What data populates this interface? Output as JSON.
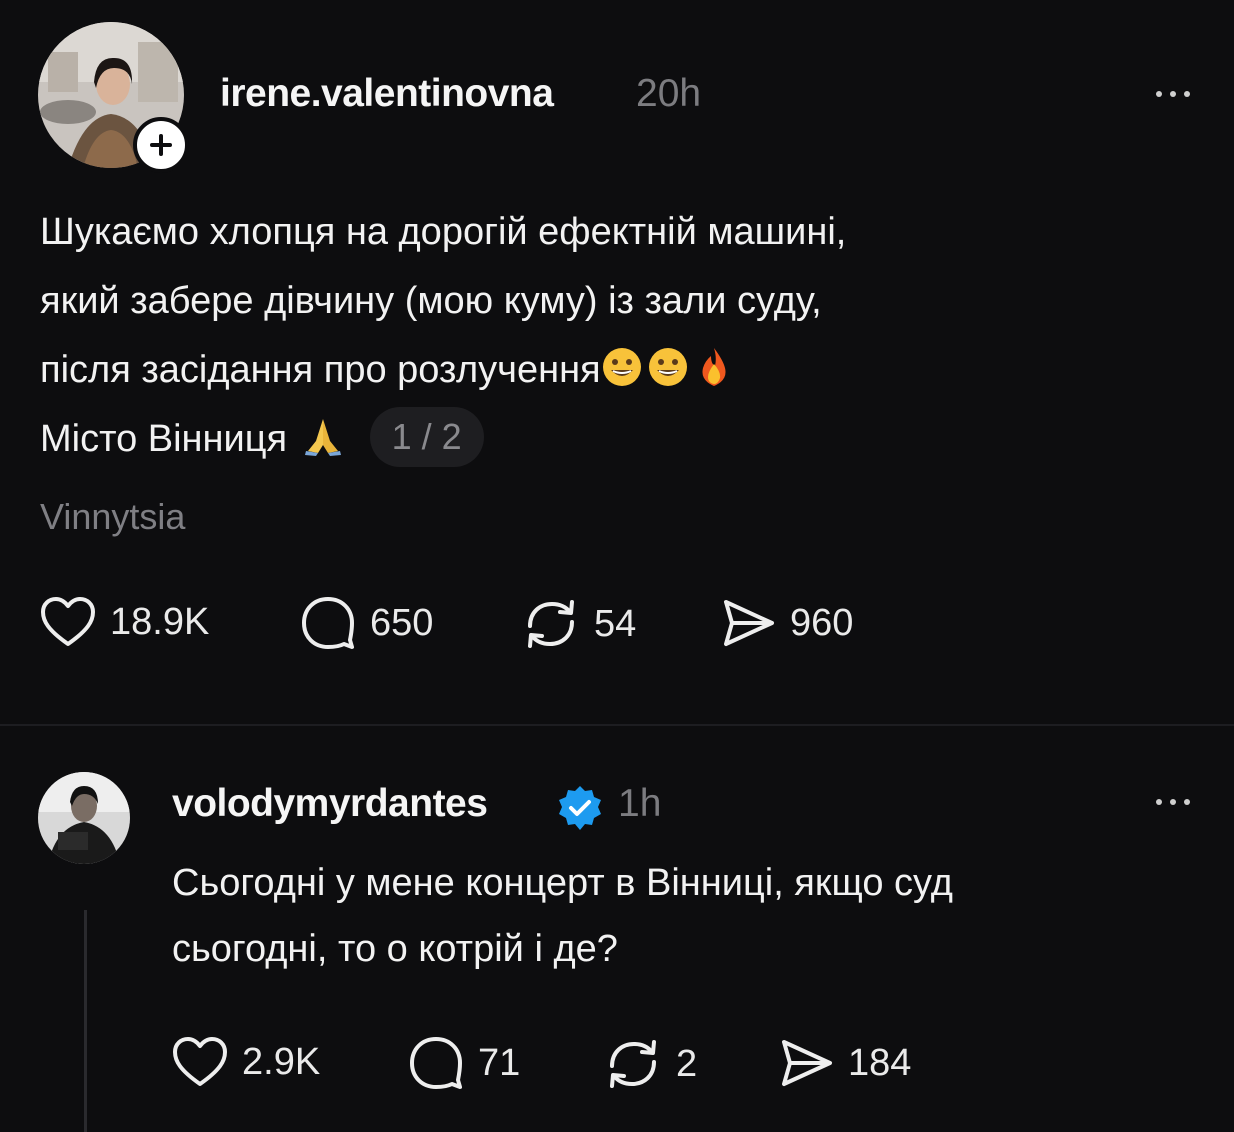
{
  "main_post": {
    "username": "irene.valentinovna",
    "time": "20h",
    "lines": [
      "Шукаємо хлопця на дорогій ефектній машині,",
      "який забере дівчину (мою куму) із зали суду,",
      "після засідання про розлучення",
      "Місто Вінниця"
    ],
    "line3_emojis": [
      "grinning-face",
      "grinning-face",
      "fire"
    ],
    "line4_emoji": "folded-hands",
    "page_indicator": "1 / 2",
    "location": "Vinnytsia",
    "likes": "18.9K",
    "comments": "650",
    "reposts": "54",
    "shares": "960"
  },
  "reply_post": {
    "username": "volodymyrdantes",
    "time": "1h",
    "lines": [
      "Сьогодні у мене концерт в Вінниці, якщо суд",
      "сьогодні, то о котрій і де?"
    ],
    "likes": "2.9K",
    "comments": "71",
    "reposts": "2",
    "shares": "184"
  },
  "icons": {
    "like": "heart-icon",
    "comment": "comment-bubble-icon",
    "repost": "repost-icon",
    "share": "send-icon",
    "more": "more-options-icon",
    "verified": "verified-badge-icon",
    "follow": "plus-icon"
  },
  "colors": {
    "background": "#0d0d0f",
    "text": "#f2f2f2",
    "muted": "#7c7c80",
    "verified": "#1d9bf0"
  }
}
